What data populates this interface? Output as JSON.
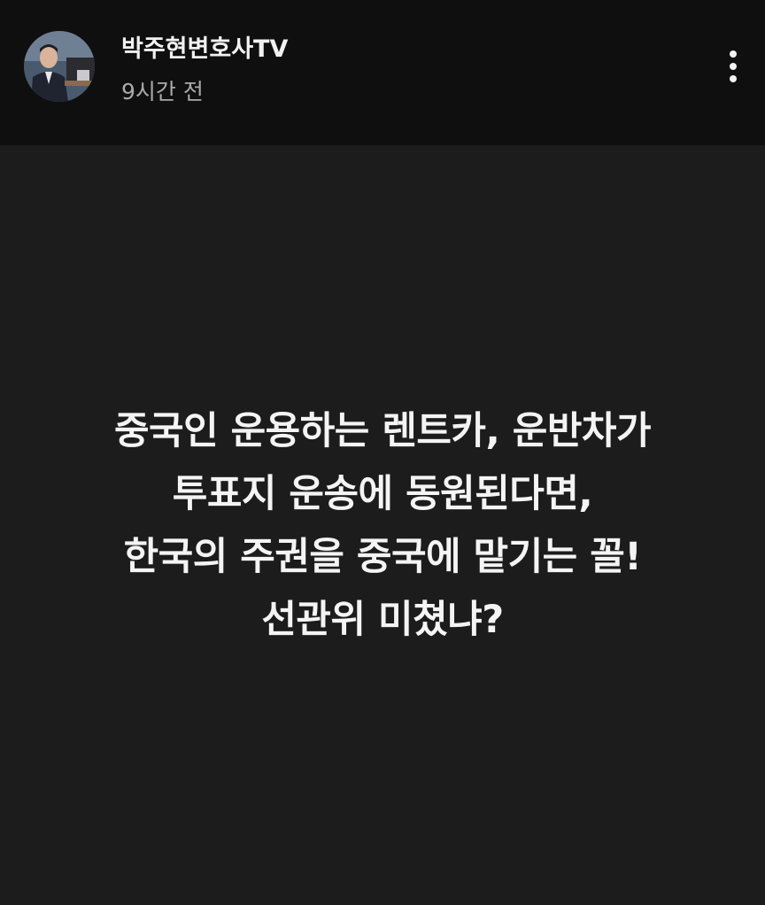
{
  "header": {
    "channel_name": "박주현변호사TV",
    "post_time": "9시간 전",
    "avatar_icon": "channel-avatar",
    "menu_icon": "more-vertical-icon"
  },
  "post": {
    "lines": [
      "중국인 운용하는 렌트카, 운반차가",
      "투표지 운송에 동원된다면,",
      "한국의 주권을 중국에 맡기는 꼴!",
      "선관위 미쳤냐?"
    ]
  },
  "colors": {
    "header_bg": "#0f0f0f",
    "body_bg": "#1c1c1c",
    "text_primary": "#f4f4f4",
    "text_secondary": "#aaaaaa"
  }
}
